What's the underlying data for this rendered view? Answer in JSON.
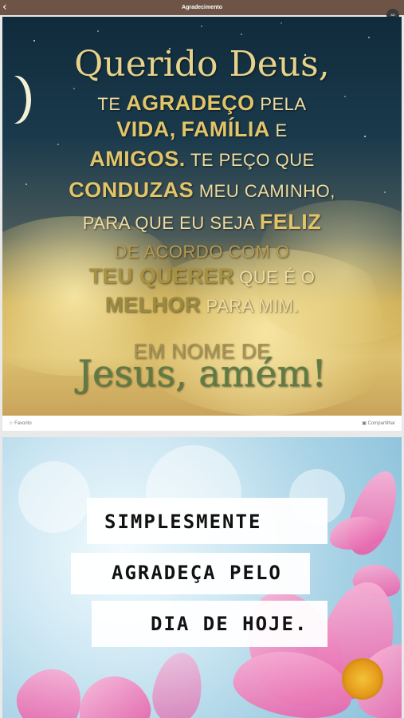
{
  "app_bar": {
    "title": "Agradecimento",
    "back_icon": "chevron-left-icon",
    "badge_text": "AD"
  },
  "post1": {
    "lines": [
      "Querido Deus,",
      "TE",
      "AGRADEÇO",
      "PELA",
      "VIDA,",
      "FAMÍLIA",
      "E",
      "AMIGOS.",
      "TE PEÇO QUE",
      "CONDUZAS",
      "MEU CAMINHO,",
      "PARA QUE EU SEJA",
      "FELIZ",
      "DE ACORDO COM O",
      "TEU QUERER",
      "QUE É O",
      "MELHOR",
      "PARA MIM.",
      "EM NOME DE",
      "Jesus, amém!"
    ],
    "favorite_label": "Favorito",
    "favorite_icon": "star-icon",
    "share_label": "Compartilhar",
    "share_icon": "share-icon"
  },
  "post2": {
    "lines": [
      "SIMPLESMENTE",
      "AGRADEÇA PELO",
      "DIA DE HOJE."
    ]
  }
}
